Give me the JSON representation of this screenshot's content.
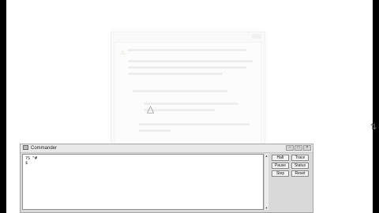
{
  "commander": {
    "title": "Commander",
    "window_controls": {
      "min": "–",
      "max": "□",
      "close": "×"
    },
    "console_text": "?S \"#\n$",
    "buttons": {
      "halt": "Halt",
      "trace": "Trace",
      "pause": "Pause",
      "status": "Status",
      "step": "Step",
      "reset": "Reset"
    },
    "scroll_up": "▲",
    "scroll_down": "▼"
  },
  "dialog": {
    "warning_icon": "⚠",
    "alert_icon": "△",
    "close": ""
  },
  "screen": {
    "cursor_icon": "⇅"
  },
  "colors": {
    "black_bar": "#000000",
    "commander_bg": "#d9d9d9"
  }
}
